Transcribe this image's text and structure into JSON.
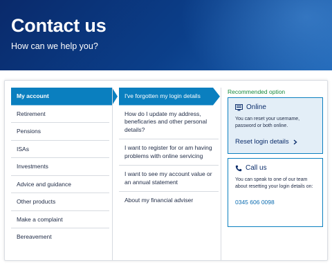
{
  "hero": {
    "title": "Contact us",
    "subtitle": "How can we help you?"
  },
  "categories": [
    {
      "label": "My account",
      "active": true
    },
    {
      "label": "Retirement"
    },
    {
      "label": "Pensions"
    },
    {
      "label": "ISAs"
    },
    {
      "label": "Investments"
    },
    {
      "label": "Advice and guidance"
    },
    {
      "label": "Other products"
    },
    {
      "label": "Make a complaint"
    },
    {
      "label": "Bereavement"
    }
  ],
  "questions": [
    {
      "label": "I've forgotten my login details",
      "active": true
    },
    {
      "label": "How do I update my address, beneficaries and other personal details?"
    },
    {
      "label": "I want to register for or am having problems with online servicing"
    },
    {
      "label": "I want to see my account value or an annual statement"
    },
    {
      "label": "About my financial adviser"
    }
  ],
  "recommended": {
    "label": "Recommended option",
    "online": {
      "title": "Online",
      "icon": "monitor-icon",
      "text": "You can reset your username, password or both online.",
      "link_label": "Reset login details"
    },
    "call": {
      "title": "Call us",
      "icon": "phone-icon",
      "text": "You can speak to one of our team about resetting your login details on:",
      "phone": "0345 606 0098"
    }
  },
  "colors": {
    "accent": "#0a7fbf",
    "hero_dark": "#0a2a6b",
    "recommended_green": "#178a3c",
    "online_box_bg": "#e3eef7"
  }
}
